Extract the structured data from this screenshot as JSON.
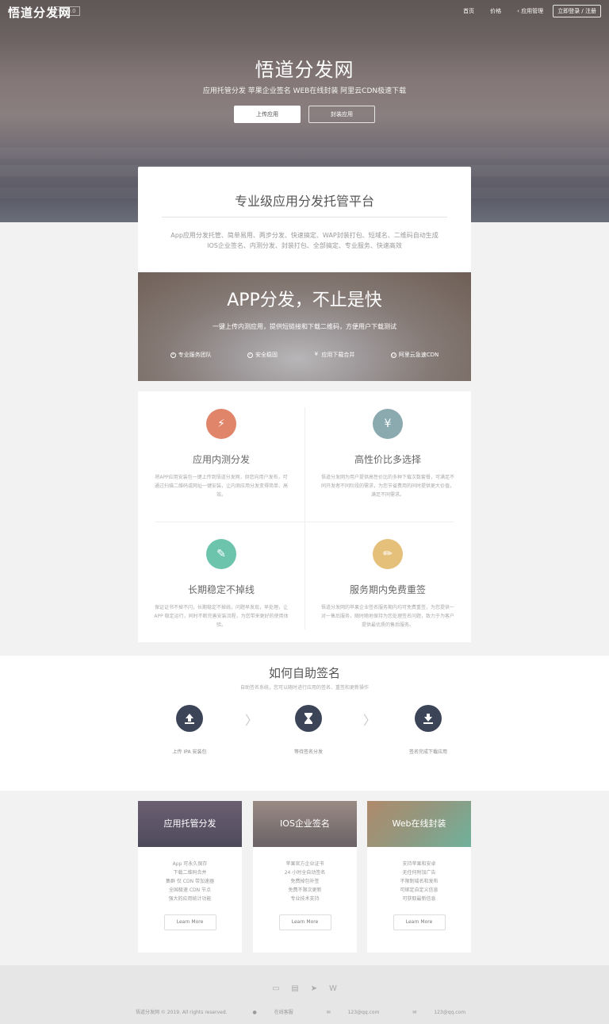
{
  "header": {
    "logo": "悟道分发网",
    "version": "V1.0.0",
    "nav": [
      "首页",
      "价格",
      "应用管理"
    ],
    "nav_button": "立即登录 / 注册"
  },
  "hero": {
    "title": "悟道分发网",
    "subtitle": "应用托管分发 苹果企业签名 WEB在线封装 阿里云CDN极速下载",
    "btn_primary": "上传应用",
    "btn_secondary": "封装应用"
  },
  "platform": {
    "title": "专业级应用分发托管平台",
    "desc_line1": "App应用分发托管、简单易用、两步分发、快速搞定、WAP封装打包、短域名、二维码自动生成",
    "desc_line2": "IOS企业签名、内测分发、封装打包、全部搞定、专业服务、快速高效"
  },
  "banner": {
    "title": "APP分发，不止是快",
    "subtitle": "一键上传内测应用，提供短链接和下载二维码，方便用户下载测试",
    "badges": [
      "专业服务团队",
      "安全稳固",
      "应用下载合并",
      "阿里云急速CDN"
    ]
  },
  "features": [
    {
      "title": "应用内测分发",
      "icon": "bolt-icon",
      "color": "#e0846a",
      "desc": "将APP应用安装包一键上传到悟道分发网，供您向用户发布，可通过扫描二维码或网址一键安装，让内测应用分发变得简单、高效。"
    },
    {
      "title": "高性价比多选择",
      "icon": "yen-icon",
      "color": "#8aaab0",
      "desc": "悟道分发网为用户提供高性价比的多种下载次数套餐，可满足不同开发者不同阶段的需求，为您节省费用的同时提供更大价值，满足不同需求。"
    },
    {
      "title": "长期稳定不掉线",
      "icon": "edit-icon",
      "color": "#6cc4ad",
      "desc": "保证证书不掉不闪，长期稳定不掉线，问题早发现，早处理，让 APP 稳定运行，同时不断完善安装流程，为您带来更好的使用体验。"
    },
    {
      "title": "服务期内免费重签",
      "icon": "pencil-icon",
      "color": "#e4c07a",
      "desc": "悟道分发网的苹果企业签名服务期内均可免费重签，为您提供一对一售后服务，随时随地保持为您处理签名问题，致力于为客户提供最优质的售后服务。"
    }
  ],
  "how": {
    "title": "如何自助签名",
    "subtitle": "自助签名系统，您可以随时进行应用的签名、重签和更新操作",
    "steps": [
      "上传 IPA 安装包",
      "等待签名分发",
      "签名完成下载应用"
    ]
  },
  "services": [
    {
      "title": "应用托管分发",
      "gradient": "linear-gradient(180deg,#6a6072 0%,#4e4a5c 100%)",
      "lines": [
        "App 可永久保存",
        "下载二维码合并",
        "集群 仅 CDN 带加速器",
        "全国极速 CDN 节点",
        "强大的应用统计功能"
      ],
      "btn": "Learn More"
    },
    {
      "title": "IOS企业签名",
      "gradient": "linear-gradient(180deg,#9a8a84 0%,#6a6266 100%)",
      "lines": [
        "苹果官方企业证书",
        "24 小时全自动签名",
        "免费掉包补签",
        "免费不限次更新",
        "专业技术支持"
      ],
      "btn": "Learn More"
    },
    {
      "title": "Web在线封装",
      "gradient": "linear-gradient(135deg,#b08a6a 0%,#8e9a82 55%,#6fb29c 100%)",
      "lines": [
        "支持苹果和安卓",
        "无任何附加广告",
        "不限制域名和发布",
        "可绑定自定义信息",
        "可获取最新信息"
      ],
      "btn": "Learn More"
    }
  ],
  "footer": {
    "icons": [
      "monitor-icon",
      "document-icon",
      "paper-plane-icon",
      "w-icon"
    ],
    "copyright": "悟道分发网 © 2019. All rights reserved.",
    "item1": "在线客服",
    "item2": "123@qq.com",
    "item3": "123@qq.com"
  }
}
